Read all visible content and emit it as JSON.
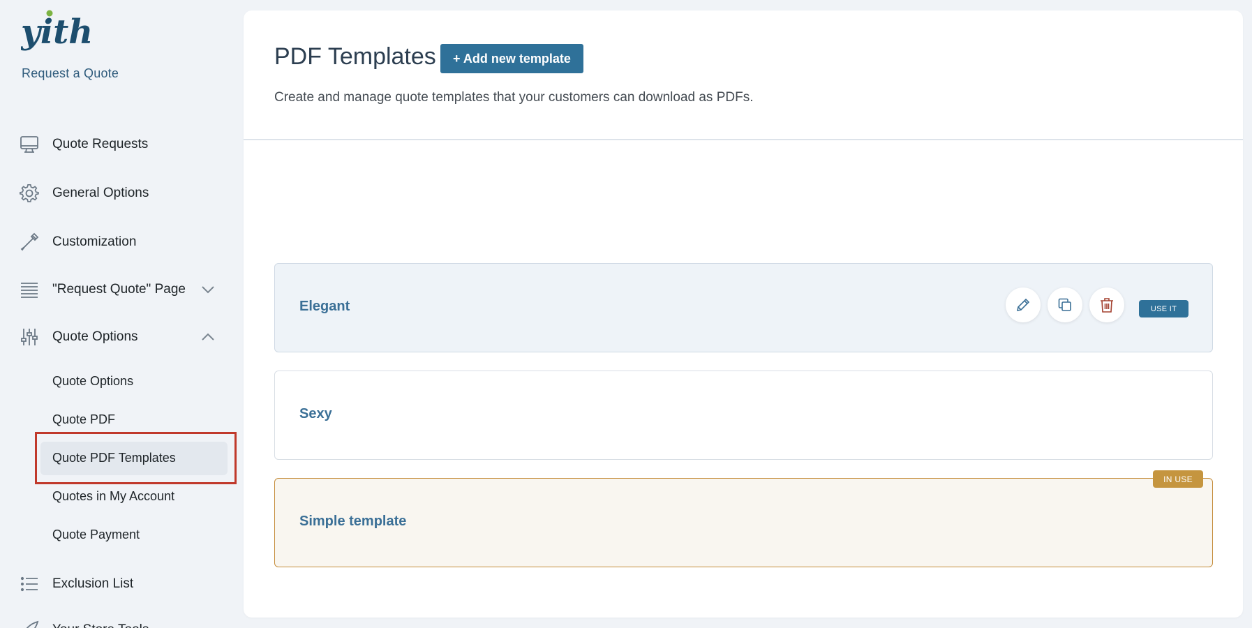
{
  "brand": {
    "logo_text": "yith",
    "subtitle": "Request a Quote"
  },
  "sidebar": {
    "items": [
      {
        "label": "Quote Requests",
        "icon": "monitor-icon"
      },
      {
        "label": "General Options",
        "icon": "gear-icon"
      },
      {
        "label": "Customization",
        "icon": "eyedropper-icon"
      },
      {
        "label": "\"Request Quote\" Page",
        "icon": "page-lines-icon",
        "expandable": true,
        "expanded": false
      },
      {
        "label": "Quote Options",
        "icon": "sliders-icon",
        "expandable": true,
        "expanded": true
      },
      {
        "label": "Exclusion List",
        "icon": "list-icon"
      },
      {
        "label": "Your Store Tools",
        "icon": "rocket-icon"
      }
    ],
    "sub_items": [
      {
        "label": "Quote Options"
      },
      {
        "label": "Quote PDF"
      },
      {
        "label": "Quote PDF Templates",
        "active": true
      },
      {
        "label": "Quotes in My Account"
      },
      {
        "label": "Quote Payment"
      }
    ]
  },
  "header": {
    "title": "PDF Templates",
    "add_button": "+ Add new template",
    "description": "Create and manage quote templates that your customers can download as PDFs."
  },
  "templates": [
    {
      "name": "Elegant",
      "state": "hover",
      "actions": [
        "edit-icon",
        "duplicate-icon",
        "trash-icon"
      ],
      "use_label": "USE IT"
    },
    {
      "name": "Sexy",
      "state": "default"
    },
    {
      "name": "Simple template",
      "state": "in-use",
      "badge": "IN USE"
    }
  ],
  "colors": {
    "accent": "#2f7199",
    "template_name": "#3a6f96",
    "in_use": "#c5953f",
    "highlight": "#c0392b"
  }
}
